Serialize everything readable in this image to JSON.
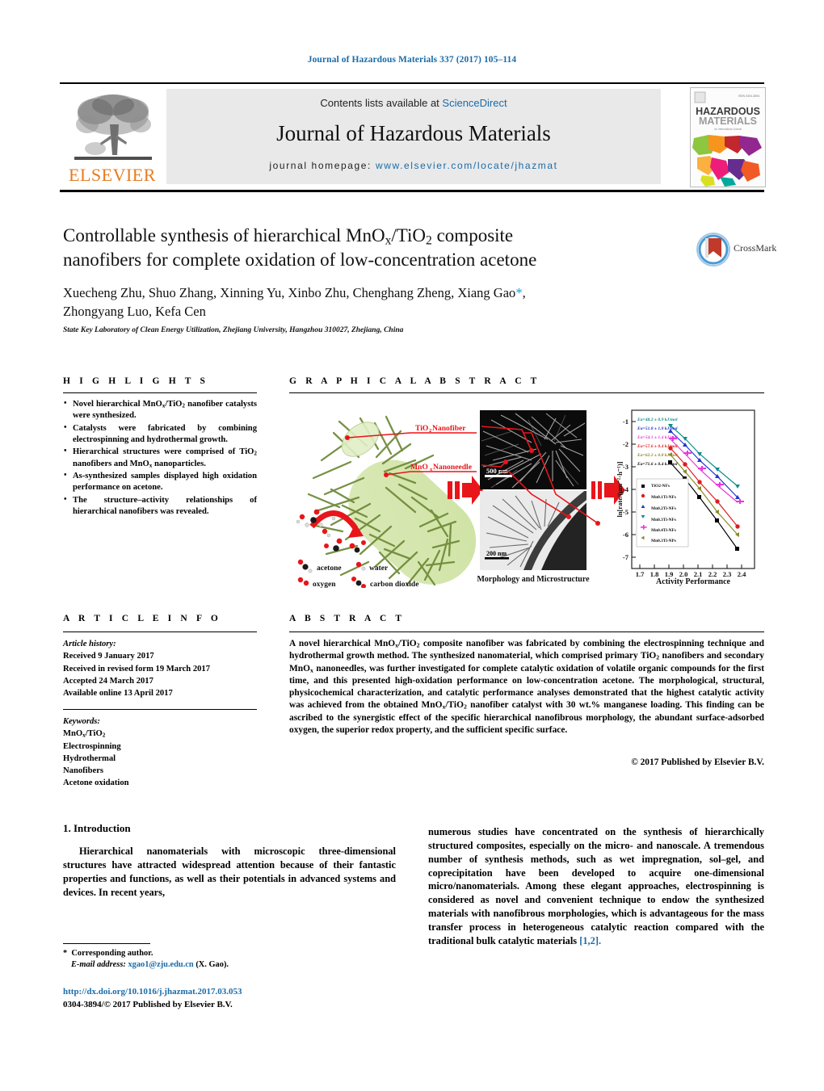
{
  "running_head": "Journal of Hazardous Materials 337 (2017) 105–114",
  "masthead": {
    "contents_prefix": "Contents lists available at ",
    "sciencedirect": "ScienceDirect",
    "journal_name": "Journal of Hazardous Materials",
    "homepage_prefix": "journal homepage: ",
    "homepage_url": "www.elsevier.com/locate/jhazmat",
    "publisher": "ELSEVIER",
    "cover_title_line1": "HAZARDOUS",
    "cover_title_line2": "MATERIALS"
  },
  "article": {
    "title_line1": "Controllable synthesis of hierarchical MnO",
    "title_sub1": "x",
    "title_line1b": "/TiO",
    "title_sub2": "2",
    "title_line1c": " composite",
    "title_line2": "nanofibers for complete oxidation of low-concentration acetone",
    "authors": "Xuecheng Zhu, Shuo Zhang, Xinning Yu, Xinbo Zhu, Chenghang Zheng, Xiang Gao",
    "authors_line2": "Zhongyang Luo, Kefa Cen",
    "corresponding_marker": "*",
    "affiliation": "State Key Laboratory of Clean Energy Utilization, Zhejiang University, Hangzhou 310027, Zhejiang, China",
    "crossmark_label": "CrossMark"
  },
  "highlights": {
    "heading": "H I G H L I G H T S",
    "items": [
      "Novel hierarchical MnOx/TiO2 nanofiber catalysts were synthesized.",
      "Catalysts were fabricated by combining electrospinning and hydrothermal growth.",
      "Hierarchical structures were comprised of TiO2 nanofibers and MnOx nanoparticles.",
      "As-synthesized samples displayed high oxidation performance on acetone.",
      "The structure–activity relationships of hierarchical nanofibers was revealed."
    ]
  },
  "graphical_abstract": {
    "heading": "G R A P H I C A L   A B S T R A C T",
    "callout_1": "TiO2 Nanofiber",
    "callout_2": "MnOx Nanoneedle",
    "legend_acetone": "acetone",
    "legend_water": "water",
    "legend_oxygen": "oxygen",
    "legend_co2": "carbon dioxide",
    "scalebar_sem": "500 nm",
    "scalebar_tem": "200 nm",
    "caption_middle": "Morphology and Microstructure",
    "caption_right": "Activity Performance"
  },
  "chart_data": {
    "type": "line",
    "title": "Activity Performance",
    "xlabel": "Activity Performance",
    "ylabel": "ln[rate/(µmol·m⁻²·h⁻¹)]",
    "xlim": [
      1.65,
      2.45
    ],
    "ylim": [
      -7,
      -0.7
    ],
    "xticks": [
      "1.7",
      "1.8",
      "1.9",
      "2.0",
      "2.1",
      "2.2",
      "2.3",
      "2.4"
    ],
    "yticks": [
      "-1",
      "-2",
      "-3",
      "-4",
      "-5",
      "-6",
      "-7"
    ],
    "x": [
      1.91,
      2.01,
      2.11,
      2.23,
      2.37
    ],
    "grid": false,
    "legend_position": "lower-left",
    "annotations": [
      "Ea=48.2 ± 0.9 kJ/mol",
      "Ea=51.8 ± 1.0 kJ/mol",
      "Ea=54.1 ± 1.4 kJ/mol",
      "Ea=57.6 ± 0.4 kJ/mol",
      "Ea=62.2 ± 0.8 kJ/mol",
      "Ea=71.6 ± 0.4 kJ/mol"
    ],
    "series": [
      {
        "name": "TiO2-NFs",
        "color": "#000000",
        "marker": "square",
        "values": [
          -2.82,
          -3.54,
          -4.37,
          -5.42,
          -6.66
        ]
      },
      {
        "name": "Mn0.1Ti-NFs",
        "color": "#e11b22",
        "marker": "circle",
        "values": [
          -2.18,
          -2.9,
          -3.68,
          -4.55,
          -5.67
        ]
      },
      {
        "name": "Mn0.2Ti-NFs",
        "color": "#2233cc",
        "marker": "triangle",
        "values": [
          -1.45,
          -2.02,
          -2.7,
          -3.43,
          -4.34
        ]
      },
      {
        "name": "Mn0.3Ti-NFs",
        "color": "#0e8c8c",
        "marker": "triangle-down",
        "values": [
          -1.2,
          -1.76,
          -2.44,
          -3.1,
          -3.85
        ]
      },
      {
        "name": "Mn0.4Ti-NFs",
        "color": "#e838dc",
        "marker": "plus",
        "values": [
          -1.78,
          -2.4,
          -3.07,
          -3.77,
          -4.57
        ]
      },
      {
        "name": "Mn0.3Ti-NPs",
        "color": "#8a8a28",
        "marker": "left",
        "values": [
          -2.45,
          -3.18,
          -3.94,
          -4.98,
          -5.96
        ]
      }
    ]
  },
  "article_info": {
    "heading": "A R T I C L E   I N F O",
    "history_label": "Article history:",
    "received": "Received 9 January 2017",
    "revised": "Received in revised form 19 March 2017",
    "accepted": "Accepted 24 March 2017",
    "online": "Available online 13 April 2017",
    "keywords_label": "Keywords:",
    "keywords": [
      "MnOx/TiO2",
      "Electrospinning",
      "Hydrothermal",
      "Nanofibers",
      "Acetone oxidation"
    ]
  },
  "abstract": {
    "heading": "A B S T R A C T",
    "text": "A novel hierarchical MnOx/TiO2 composite nanofiber was fabricated by combining the electrospinning technique and hydrothermal growth method. The synthesized nanomaterial, which comprised primary TiO2 nanofibers and secondary MnOx nanoneedles, was further investigated for complete catalytic oxidation of volatile organic compounds for the first time, and this presented high-oxidation performance on low-concentration acetone. The morphological, structural, physicochemical characterization, and catalytic performance analyses demonstrated that the highest catalytic activity was achieved from the obtained MnOx/TiO2 nanofiber catalyst with 30 wt.% manganese loading. This finding can be ascribed to the synergistic effect of the specific hierarchical nanofibrous morphology, the abundant surface-adsorbed oxygen, the superior redox property, and the sufficient specific surface.",
    "copyright": "© 2017 Published by Elsevier B.V."
  },
  "introduction": {
    "section_number_title": "1.  Introduction",
    "paragraph_left": "Hierarchical nanomaterials with microscopic three-dimensional structures have attracted widespread attention because of their fantastic properties and functions, as well as their potentials in advanced systems and devices. In recent years,",
    "paragraph_right": "numerous studies have concentrated on the synthesis of hierarchically structured composites, especially on the micro- and nanoscale. A tremendous number of synthesis methods, such as wet impregnation, sol–gel, and coprecipitation have been developed to acquire one-dimensional micro/nanomaterials. Among these elegant approaches, electrospinning is considered as novel and convenient technique to endow the synthesized materials with nanofibrous morphologies, which is advantageous for the mass transfer process in heterogeneous catalytic reaction compared with the traditional bulk catalytic materials",
    "reference_link": "[1,2]."
  },
  "footer": {
    "corresponding_author": "Corresponding author.",
    "email_label": "E-mail address:",
    "email": "xgao1@zju.edu.cn",
    "email_owner": "(X. Gao).",
    "doi": "http://dx.doi.org/10.1016/j.jhazmat.2017.03.053",
    "issn_line": "0304-3894/© 2017 Published by Elsevier B.V."
  },
  "colors": {
    "link": "#1a6ba8",
    "elsevier_orange": "#E87B20",
    "band_gray": "#e9e9e9"
  }
}
